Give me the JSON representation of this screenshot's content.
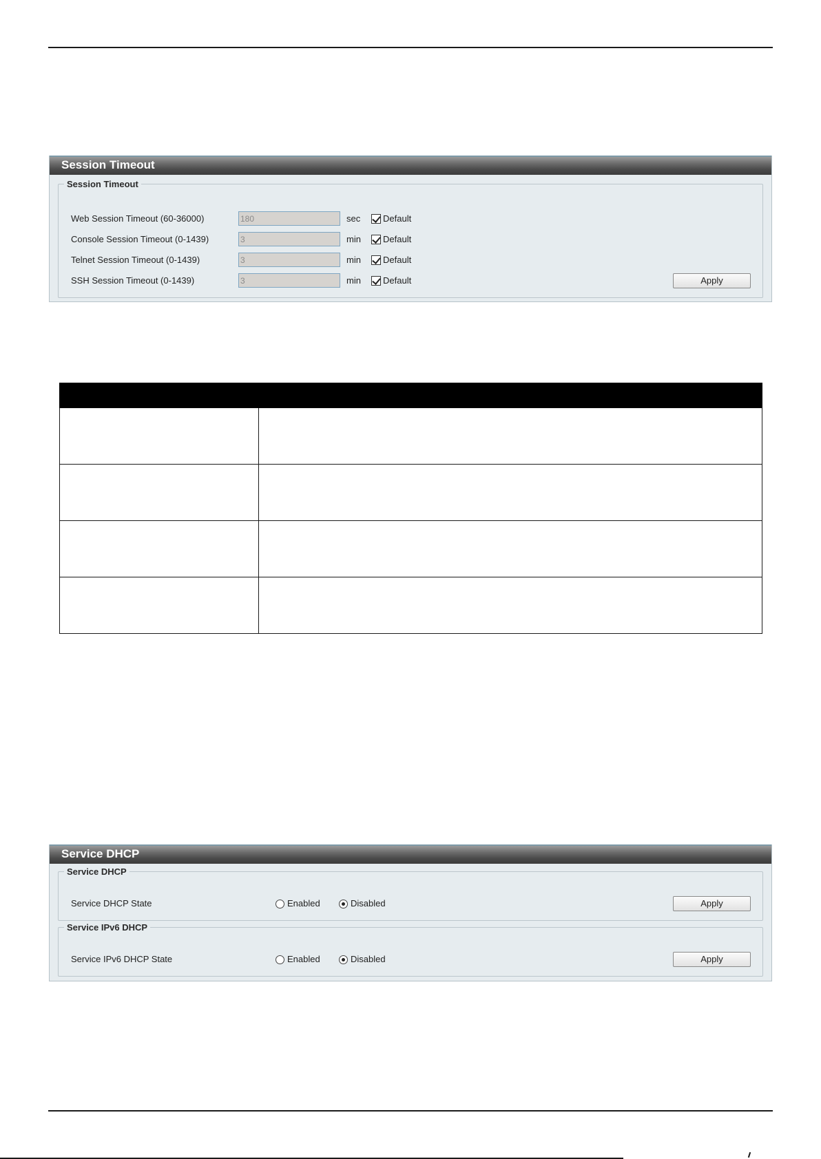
{
  "session_panel": {
    "title": "Session Timeout",
    "group_title": "Session Timeout",
    "rows": [
      {
        "label": "Web Session Timeout (60-36000)",
        "value": "180",
        "unit": "sec",
        "checkbox_label": "Default",
        "checked": true
      },
      {
        "label": "Console Session Timeout (0-1439)",
        "value": "3",
        "unit": "min",
        "checkbox_label": "Default",
        "checked": true
      },
      {
        "label": "Telnet Session Timeout (0-1439)",
        "value": "3",
        "unit": "min",
        "checkbox_label": "Default",
        "checked": true
      },
      {
        "label": "SSH Session Timeout (0-1439)",
        "value": "3",
        "unit": "min",
        "checkbox_label": "Default",
        "checked": true
      }
    ],
    "apply_label": "Apply"
  },
  "dhcp_panel": {
    "title": "Service DHCP",
    "groups": [
      {
        "title": "Service DHCP",
        "label": "Service DHCP State",
        "enabled_label": "Enabled",
        "disabled_label": "Disabled",
        "selected": "Disabled",
        "apply_label": "Apply"
      },
      {
        "title": "Service IPv6 DHCP",
        "label": "Service IPv6 DHCP State",
        "enabled_label": "Enabled",
        "disabled_label": "Disabled",
        "selected": "Disabled",
        "apply_label": "Apply"
      }
    ]
  },
  "description_table": {
    "columns": [
      "",
      ""
    ],
    "rows": [
      [
        "",
        ""
      ],
      [
        "",
        ""
      ],
      [
        "",
        ""
      ],
      [
        "",
        ""
      ]
    ]
  }
}
